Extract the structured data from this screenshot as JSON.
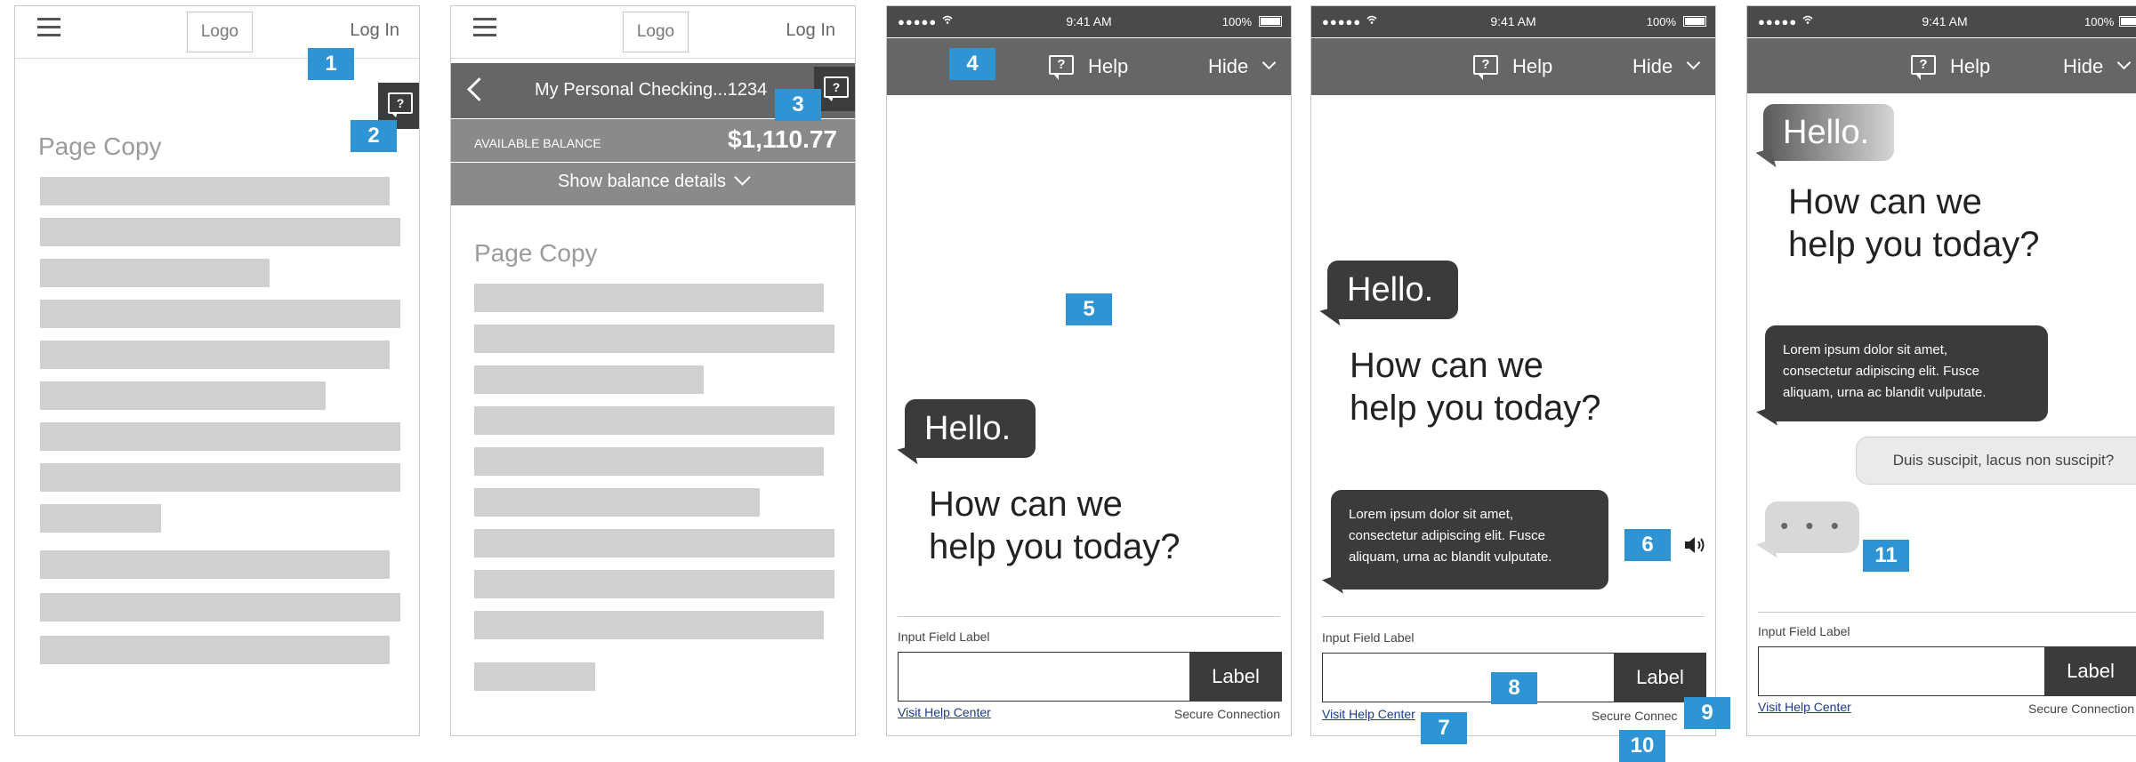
{
  "panel1": {
    "logo": "Logo",
    "login": "Log In",
    "page_copy": "Page Copy"
  },
  "panel2": {
    "logo": "Logo",
    "login": "Log In",
    "account_title": "My Personal Checking...1234",
    "balance_label": "AVAILABLE BALANCE",
    "balance_value": "$1,110.77",
    "details_toggle": "Show balance details",
    "page_copy": "Page Copy"
  },
  "status_bar": {
    "signal": "●●●●●",
    "time": "9:41 AM",
    "battery": "100%"
  },
  "help_header": {
    "help_label": "Help",
    "hide_label": "Hide"
  },
  "chat": {
    "hello": "Hello.",
    "greeting_line1": "How can we",
    "greeting_line2": "help you today?",
    "bot_message_line1": "Lorem ipsum dolor sit amet,",
    "bot_message_line2": "consectetur adipiscing elit. Fusce",
    "bot_message_line3": "aliquam, urna ac blandit vulputate.",
    "user_message": "Duis suscipit, lacus non suscipit?",
    "typing_dots": "• • •"
  },
  "form": {
    "input_label": "Input Field Label",
    "button_label": "Label",
    "help_center_link": "Visit Help Center",
    "secure_connection": "Secure Connection",
    "secure_connection_clipped": "Secure Connec",
    "secure_connection_p5": "Secure Connection"
  },
  "markers": [
    "1",
    "2",
    "3",
    "4",
    "5",
    "6",
    "7",
    "8",
    "9",
    "10",
    "11"
  ],
  "colors": {
    "marker_blue": "#2e94d4",
    "header_gray": "#666666",
    "bubble_dark": "#3b3b3b",
    "placeholder_bar": "#d0d0d0"
  }
}
